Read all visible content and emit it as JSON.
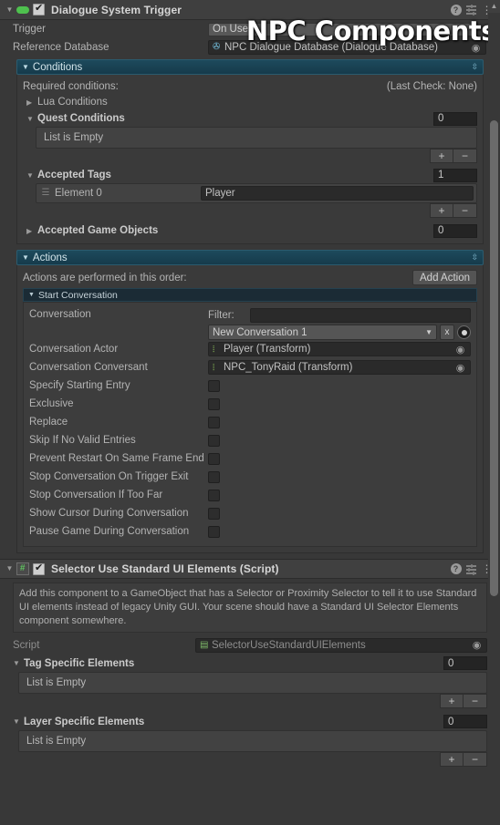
{
  "overlay": {
    "title": "NPC Components"
  },
  "components": [
    {
      "name": "Dialogue System Trigger",
      "icon": "dialogue-capsule-icon",
      "enabled": true,
      "header_icons": {
        "help": "?",
        "preset": "preset-icon",
        "menu": "kebab-menu-icon"
      },
      "fields": {
        "trigger_label": "Trigger",
        "trigger_value": "On Use",
        "reference_database_label": "Reference Database",
        "reference_database_value": "NPC Dialogue Database (Dialogue Database)"
      },
      "conditions": {
        "title": "Conditions",
        "required_label": "Required conditions:",
        "last_check": "(Last Check: None)",
        "lua_conditions_label": "Lua Conditions",
        "quest_conditions_label": "Quest Conditions",
        "quest_conditions_count": "0",
        "quest_list_empty": "List is Empty",
        "accepted_tags_label": "Accepted Tags",
        "accepted_tags_count": "1",
        "tag_element_label": "Element 0",
        "tag_element_value": "Player",
        "accepted_game_objects_label": "Accepted Game Objects",
        "accepted_game_objects_count": "0",
        "add_button": "+",
        "remove_button": "−"
      },
      "actions": {
        "title": "Actions",
        "order_label": "Actions are performed in this order:",
        "add_action_button": "Add Action",
        "start_conversation_title": "Start Conversation",
        "conversation_label": "Conversation",
        "filter_label": "Filter:",
        "filter_value": "",
        "conversation_value": "New Conversation 1",
        "clear_button": "x",
        "actor_label": "Conversation Actor",
        "actor_value": "Player (Transform)",
        "conversant_label": "Conversation Conversant",
        "conversant_value": "NPC_TonyRaid (Transform)",
        "toggles": [
          {
            "label": "Specify Starting Entry",
            "checked": false
          },
          {
            "label": "Exclusive",
            "checked": false
          },
          {
            "label": "Replace",
            "checked": false
          },
          {
            "label": "Skip If No Valid Entries",
            "checked": false
          },
          {
            "label": "Prevent Restart On Same Frame End",
            "checked": false
          },
          {
            "label": "Stop Conversation On Trigger Exit",
            "checked": false
          },
          {
            "label": "Stop Conversation If Too Far",
            "checked": false
          },
          {
            "label": "Show Cursor During Conversation",
            "checked": false
          },
          {
            "label": "Pause Game During Conversation",
            "checked": false
          }
        ]
      }
    },
    {
      "name": "Selector Use Standard UI Elements (Script)",
      "icon": "csharp-script-icon",
      "enabled": true,
      "help_text": "Add this component to a GameObject that has a Selector or Proximity Selector to tell it to use Standard UI elements instead of legacy Unity GUI. Your scene should have a Standard UI Selector Elements component somewhere.",
      "script_label": "Script",
      "script_value": "SelectorUseStandardUIElements",
      "tag_specific": {
        "label": "Tag Specific Elements",
        "count": "0",
        "list_empty": "List is Empty",
        "add_button": "+",
        "remove_button": "−"
      },
      "layer_specific": {
        "label": "Layer Specific Elements",
        "count": "0",
        "list_empty": "List is Empty",
        "add_button": "+",
        "remove_button": "−"
      }
    }
  ],
  "colors": {
    "background": "#383838",
    "header": "#3f3f3f",
    "teal_section": "#1d4a5c",
    "field_dark": "#2a2a2a",
    "script_green": "#5fbf5f",
    "transform_green": "#8fc45a",
    "objref_blue": "#78c8e8"
  }
}
